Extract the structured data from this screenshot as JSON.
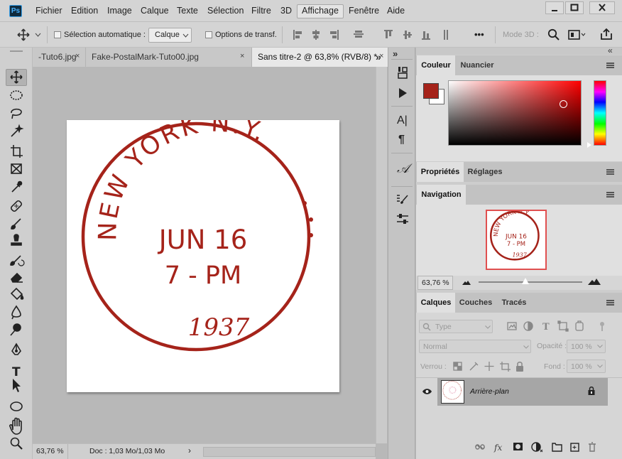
{
  "app": {
    "logo": "Ps"
  },
  "menu": {
    "items": [
      "Fichier",
      "Edition",
      "Image",
      "Calque",
      "Texte",
      "Sélection",
      "Filtre",
      "3D",
      "Affichage",
      "Fenêtre",
      "Aide"
    ],
    "active": "Affichage"
  },
  "window_controls": {
    "minimize": "minimize-icon",
    "maximize": "maximize-icon",
    "close": "close-icon"
  },
  "options": {
    "auto_select_label": "Sélection automatique :",
    "auto_select_value": "Calque",
    "transform_label": "Options de transf.",
    "more_label": "•••",
    "mode3d_label": "Mode 3D :"
  },
  "tabs": [
    {
      "label": "-Tuto6.jpg",
      "close": "×"
    },
    {
      "label": "Fake-PostalMark-Tuto00.jpg",
      "close": "×"
    },
    {
      "label": "Sans titre-2 @ 63,8% (RVB/8) *",
      "close": "×",
      "active": true
    }
  ],
  "tabs_overflow": "»",
  "panel_collapse": "»",
  "tools": [
    "move-tool",
    "marquee-tool",
    "lasso-tool",
    "magic-wand-tool",
    "crop-tool",
    "frame-tool",
    "eyedropper-tool",
    "healing-tool",
    "brush-tool",
    "stamp-tool",
    "history-brush-tool",
    "eraser-tool",
    "bucket-tool",
    "blur-tool",
    "dodge-tool",
    "pen-tool",
    "type-tool",
    "path-select-tool",
    "shape-tool",
    "hand-tool",
    "zoom-tool"
  ],
  "type_tool_glyph": "T",
  "stamp": {
    "arc_text": "NEW YORK N.Y.",
    "date": "JUN 16",
    "time": "7 - PM",
    "year": "1937",
    "color": "#a5231a"
  },
  "status": {
    "zoom": "63,76 %",
    "doc": "Doc : 1,03 Mo/1,03 Mo",
    "arrow": "›"
  },
  "color_panel": {
    "tabs": [
      "Couleur",
      "Nuancier"
    ],
    "foreground": "#a5231a",
    "background": "#ffffff"
  },
  "properties_panel": {
    "tabs": [
      "Propriétés",
      "Réglages"
    ]
  },
  "navigation_panel": {
    "title": "Navigation",
    "zoom": "63,76 %"
  },
  "layers_panel": {
    "tabs": [
      "Calques",
      "Couches",
      "Tracés"
    ],
    "filter_placeholder": "Type",
    "blend_mode": "Normal",
    "opacity_label": "Opacité :",
    "opacity_value": "100 %",
    "lock_label": "Verrou :",
    "fill_label": "Fond :",
    "fill_value": "100 %",
    "layers": [
      {
        "name": "Arrière-plan",
        "visible": true,
        "locked": true
      }
    ],
    "fx_label": "fx"
  },
  "mid_glyphs": {
    "text": "A|",
    "paragraph": "¶",
    "glyphs": "𝒜"
  }
}
